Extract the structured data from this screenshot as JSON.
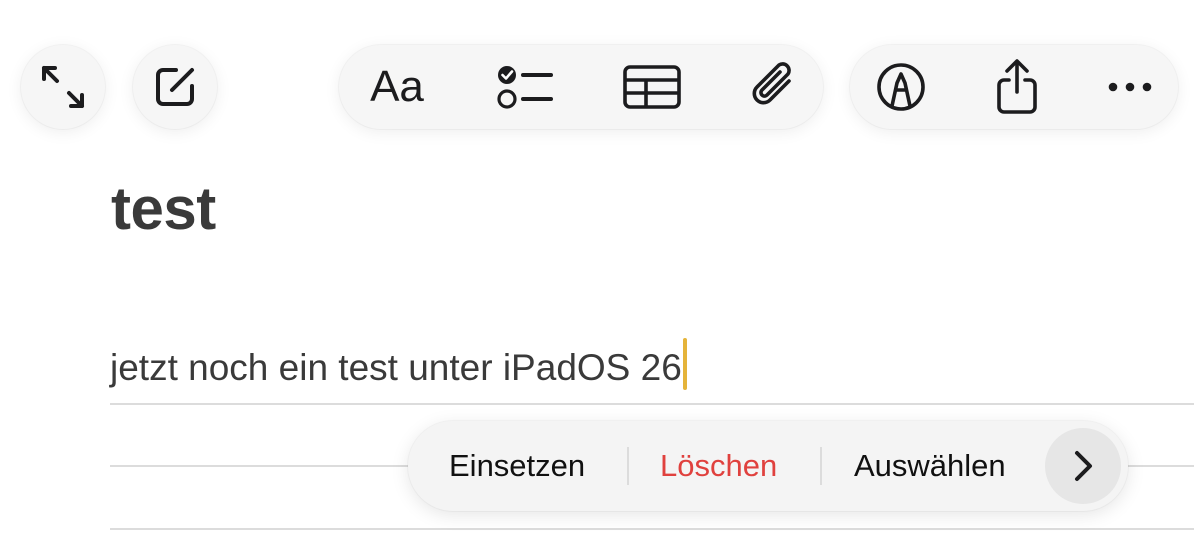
{
  "toolbar": {
    "left": [
      {
        "name": "expand",
        "icon": "expand-arrows-icon"
      },
      {
        "name": "new-note",
        "icon": "compose-icon"
      }
    ],
    "format": {
      "format_label": "Aa",
      "icon": "text-format-icon"
    },
    "center": [
      {
        "name": "checklist",
        "icon": "checklist-icon"
      },
      {
        "name": "table",
        "icon": "table-icon"
      },
      {
        "name": "attachment",
        "icon": "paperclip-icon"
      }
    ],
    "right": [
      {
        "name": "markup",
        "icon": "markup-pen-icon"
      },
      {
        "name": "share",
        "icon": "share-icon"
      },
      {
        "name": "more",
        "icon": "ellipsis-icon"
      }
    ]
  },
  "note": {
    "title": "test",
    "body": "jetzt noch ein test unter iPadOS 26"
  },
  "context_menu": {
    "items": [
      {
        "label": "Einsetzen",
        "style": "normal"
      },
      {
        "label": "Löschen",
        "style": "destructive"
      },
      {
        "label": "Auswählen",
        "style": "normal"
      }
    ],
    "more_icon": "chevron-right-icon"
  },
  "colors": {
    "caret": "#e5b43a",
    "destructive": "#e0413e",
    "text": "#3a3a3a",
    "toolbar_bg": "#f6f6f6"
  }
}
